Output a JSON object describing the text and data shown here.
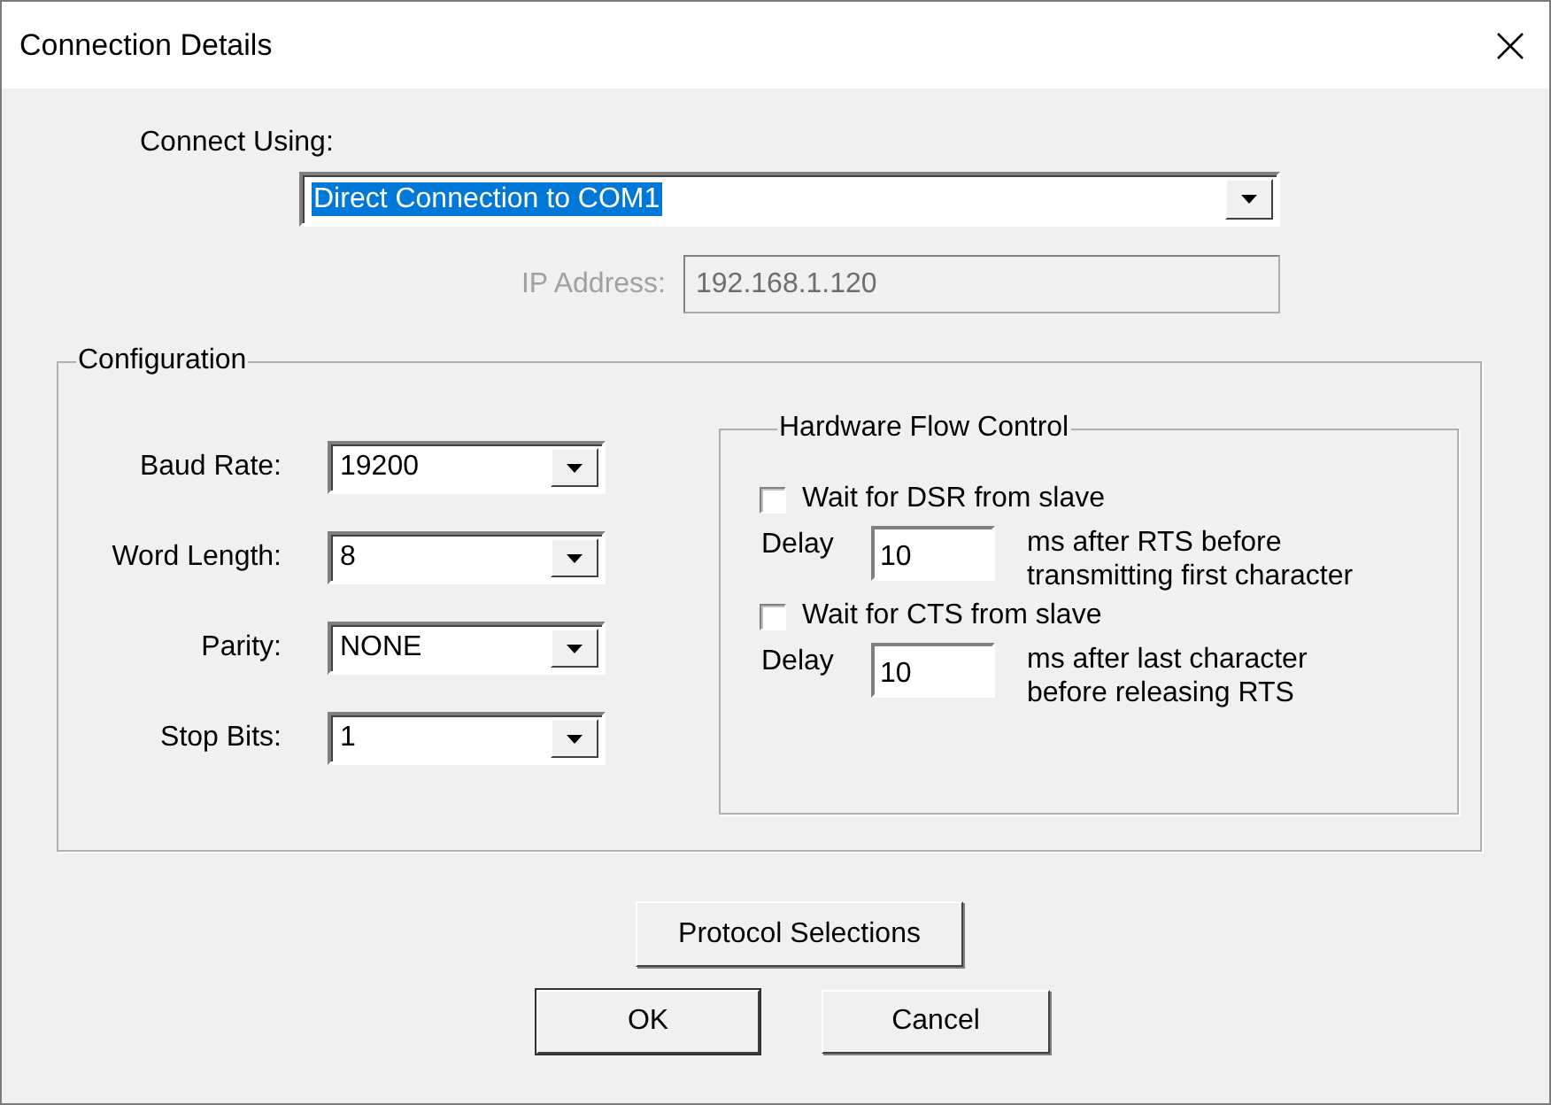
{
  "window": {
    "title": "Connection Details"
  },
  "connect_using": {
    "label": "Connect Using:",
    "value": "Direct Connection to COM1",
    "highlighted": true
  },
  "ip_address": {
    "label": "IP Address:",
    "value": "192.168.1.120",
    "disabled": true
  },
  "configuration": {
    "title": "Configuration",
    "fields": [
      {
        "label": "Baud Rate:",
        "value": "19200"
      },
      {
        "label": "Word Length:",
        "value": "8"
      },
      {
        "label": "Parity:",
        "value": "NONE"
      },
      {
        "label": "Stop Bits:",
        "value": "1"
      }
    ]
  },
  "hardware_flow_control": {
    "title": "Hardware Flow Control",
    "options": [
      {
        "label": "Wait for DSR from slave",
        "checked": false,
        "delay_label": "Delay",
        "delay": "10",
        "note": "ms after RTS before\ntransmitting first character"
      },
      {
        "label": "Wait for CTS from slave",
        "checked": false,
        "delay_label": "Delay",
        "delay": "10",
        "note": "ms after last character\nbefore releasing RTS"
      }
    ]
  },
  "protocol_button": {
    "label": "Protocol Selections"
  },
  "buttons": [
    {
      "label": "OK",
      "default": true
    },
    {
      "label": "Cancel",
      "default": false
    }
  ]
}
